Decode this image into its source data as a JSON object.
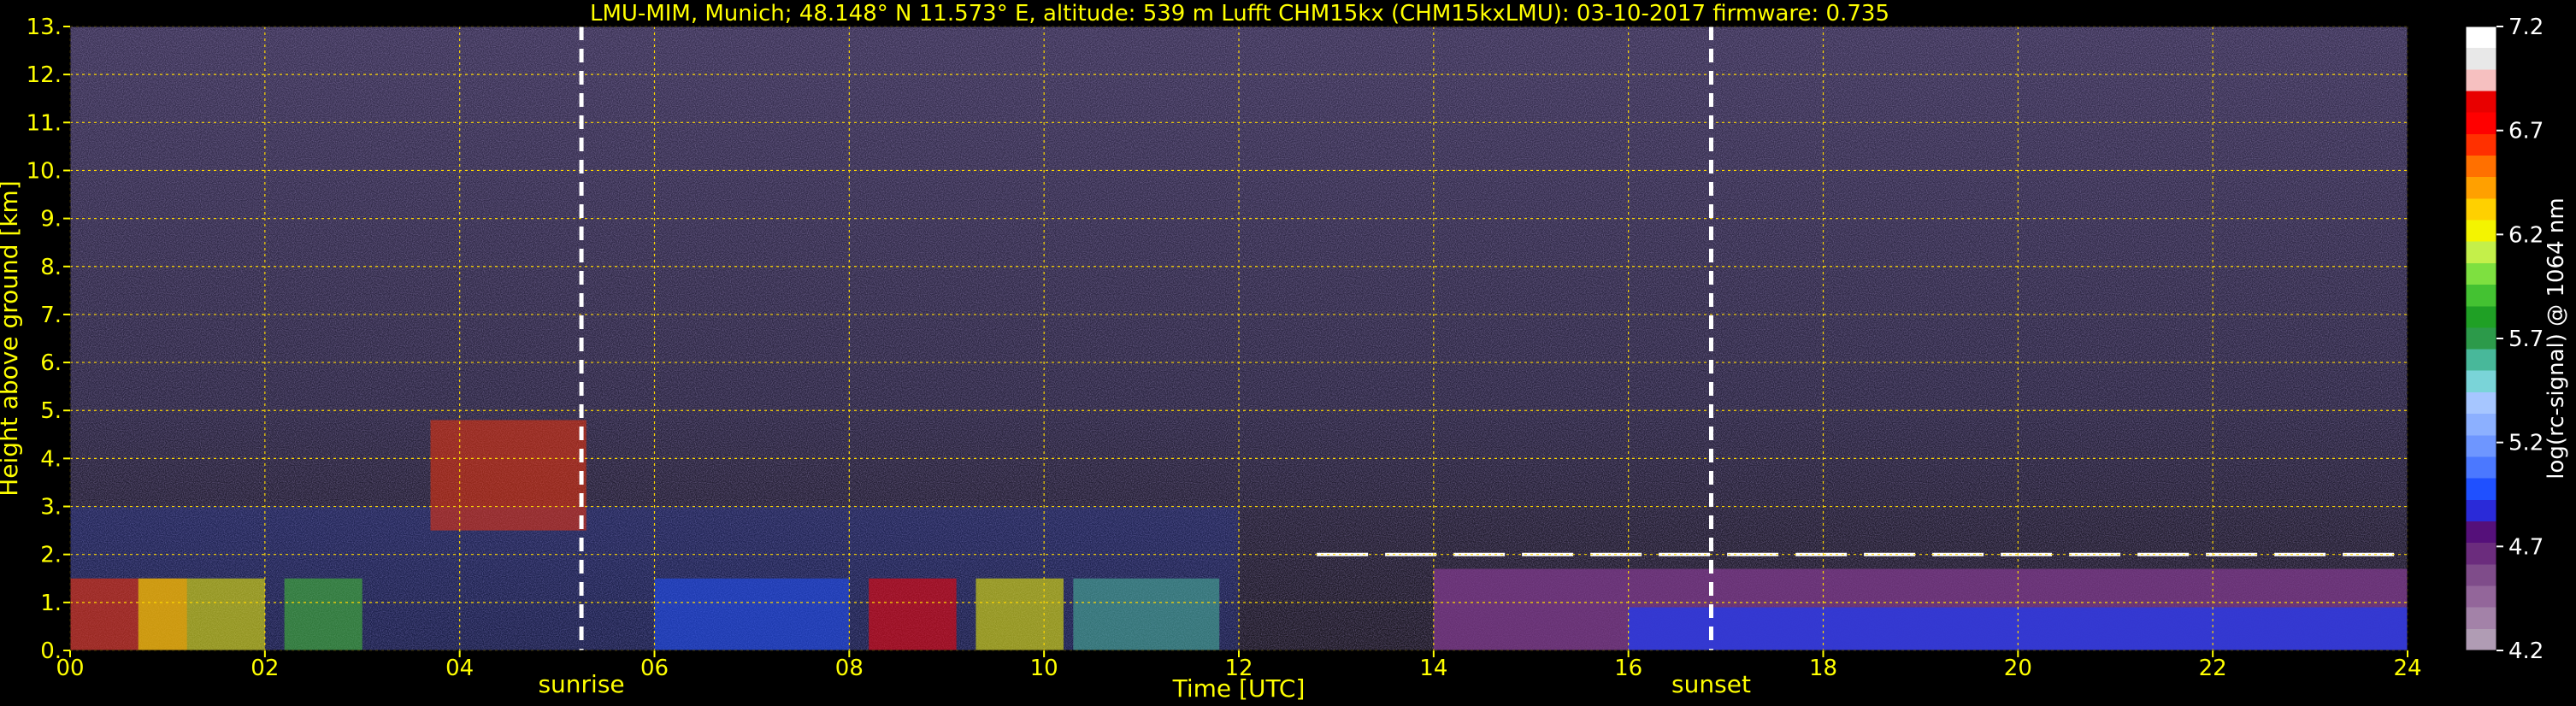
{
  "chart_data": {
    "type": "heatmap",
    "title": "LMU-MIM, Munich; 48.148° N 11.573° E, altitude: 539 m    Lufft CHM15kx (CHM15kxLMU): 03-10-2017    firmware: 0.735",
    "xlabel": "Time [UTC]",
    "ylabel": "Height above ground [km]",
    "colorbar_label": "log(rc-signal) @ 1064 nm",
    "xlim": [
      0,
      24
    ],
    "ylim": [
      0,
      13
    ],
    "x_ticks": [
      "00",
      "02",
      "04",
      "06",
      "08",
      "10",
      "12",
      "14",
      "16",
      "18",
      "20",
      "22",
      "24"
    ],
    "y_ticks": [
      "0.",
      "1.",
      "2.",
      "3.",
      "4.",
      "5.",
      "6.",
      "7.",
      "8.",
      "9.",
      "10.",
      "11.",
      "12.",
      "13."
    ],
    "colorbar_range": [
      4.2,
      7.2
    ],
    "colorbar_ticks": [
      "4.2",
      "4.7",
      "5.2",
      "5.7",
      "6.2",
      "6.7",
      "7.2"
    ],
    "colorbar_colors": [
      "#b09cb4",
      "#a382a8",
      "#93669a",
      "#7f4c8a",
      "#6b2c7d",
      "#55107a",
      "#2a2ad8",
      "#1f50ff",
      "#4b78ff",
      "#6e96ff",
      "#8cb0ff",
      "#a6c6ff",
      "#7ad4d8",
      "#48b89a",
      "#2c9a4a",
      "#1fa025",
      "#44c232",
      "#7ee040",
      "#c4f04a",
      "#f4f400",
      "#ffd000",
      "#ffa000",
      "#ff7000",
      "#ff3000",
      "#ff0000",
      "#e80000",
      "#f6c0c0",
      "#e8e8e8",
      "#ffffff"
    ],
    "grid": true,
    "grid_color": "#ffd800",
    "events": [
      {
        "name": "sunrise",
        "time": 5.25
      },
      {
        "name": "sunset",
        "time": 16.85
      }
    ],
    "layers": [
      {
        "name": "cloud layer",
        "t_start": 12.8,
        "t_end": 24,
        "height_km": 2.0
      },
      {
        "name": "boundary layer (purple)",
        "t_start": 14.0,
        "t_end": 24,
        "top_km": 1.7
      },
      {
        "name": "low layer (blue)",
        "t_start": 16.0,
        "t_end": 24,
        "top_km": 0.9
      },
      {
        "name": "strong return",
        "t_start": 0,
        "t_end": 12.0,
        "top_km": 3.0
      }
    ]
  }
}
